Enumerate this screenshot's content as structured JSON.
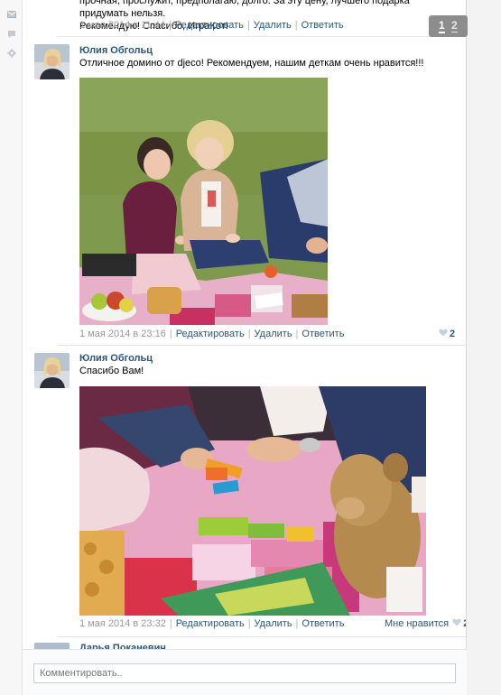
{
  "icons": {
    "rail": [
      "mail-icon",
      "comment-icon",
      "gear-icon"
    ],
    "like": "heart-icon"
  },
  "colors": {
    "link": "#2b587a",
    "meta": "#999999",
    "page_switch_bg": "#8d8d8d"
  },
  "top_comment": {
    "text_line1": "прочная, прослужит, предполагаю, долго. За эту цену, лучшего подарка придумать нельзя.",
    "text_line2": "Рекомендую! Спасибо, ИграКот!",
    "date": "1 мая 2014 в 11:44",
    "edit": "Редактировать",
    "delete": "Удалить",
    "reply": "Ответить"
  },
  "pagination": {
    "page1": "1",
    "page2": "2"
  },
  "comments": [
    {
      "author": "Юлия Обгольц",
      "text": "Отличное домино от djeco! Рекомендуем, нашим деткам очень нравится!!!",
      "date": "1 мая 2014 в 23:16",
      "edit": "Редактировать",
      "delete": "Удалить",
      "reply": "Ответить",
      "like_count": "2"
    },
    {
      "author": "Юлия Обгольц",
      "text": "Спасибо Вам!",
      "date": "1 мая 2014 в 23:32",
      "edit": "Редактировать",
      "delete": "Удалить",
      "reply": "Ответить",
      "like_label": "Мне нравится",
      "like_count": "2"
    },
    {
      "author": "Дарья Поканевич"
    }
  ],
  "composer": {
    "placeholder": "Комментировать.."
  }
}
